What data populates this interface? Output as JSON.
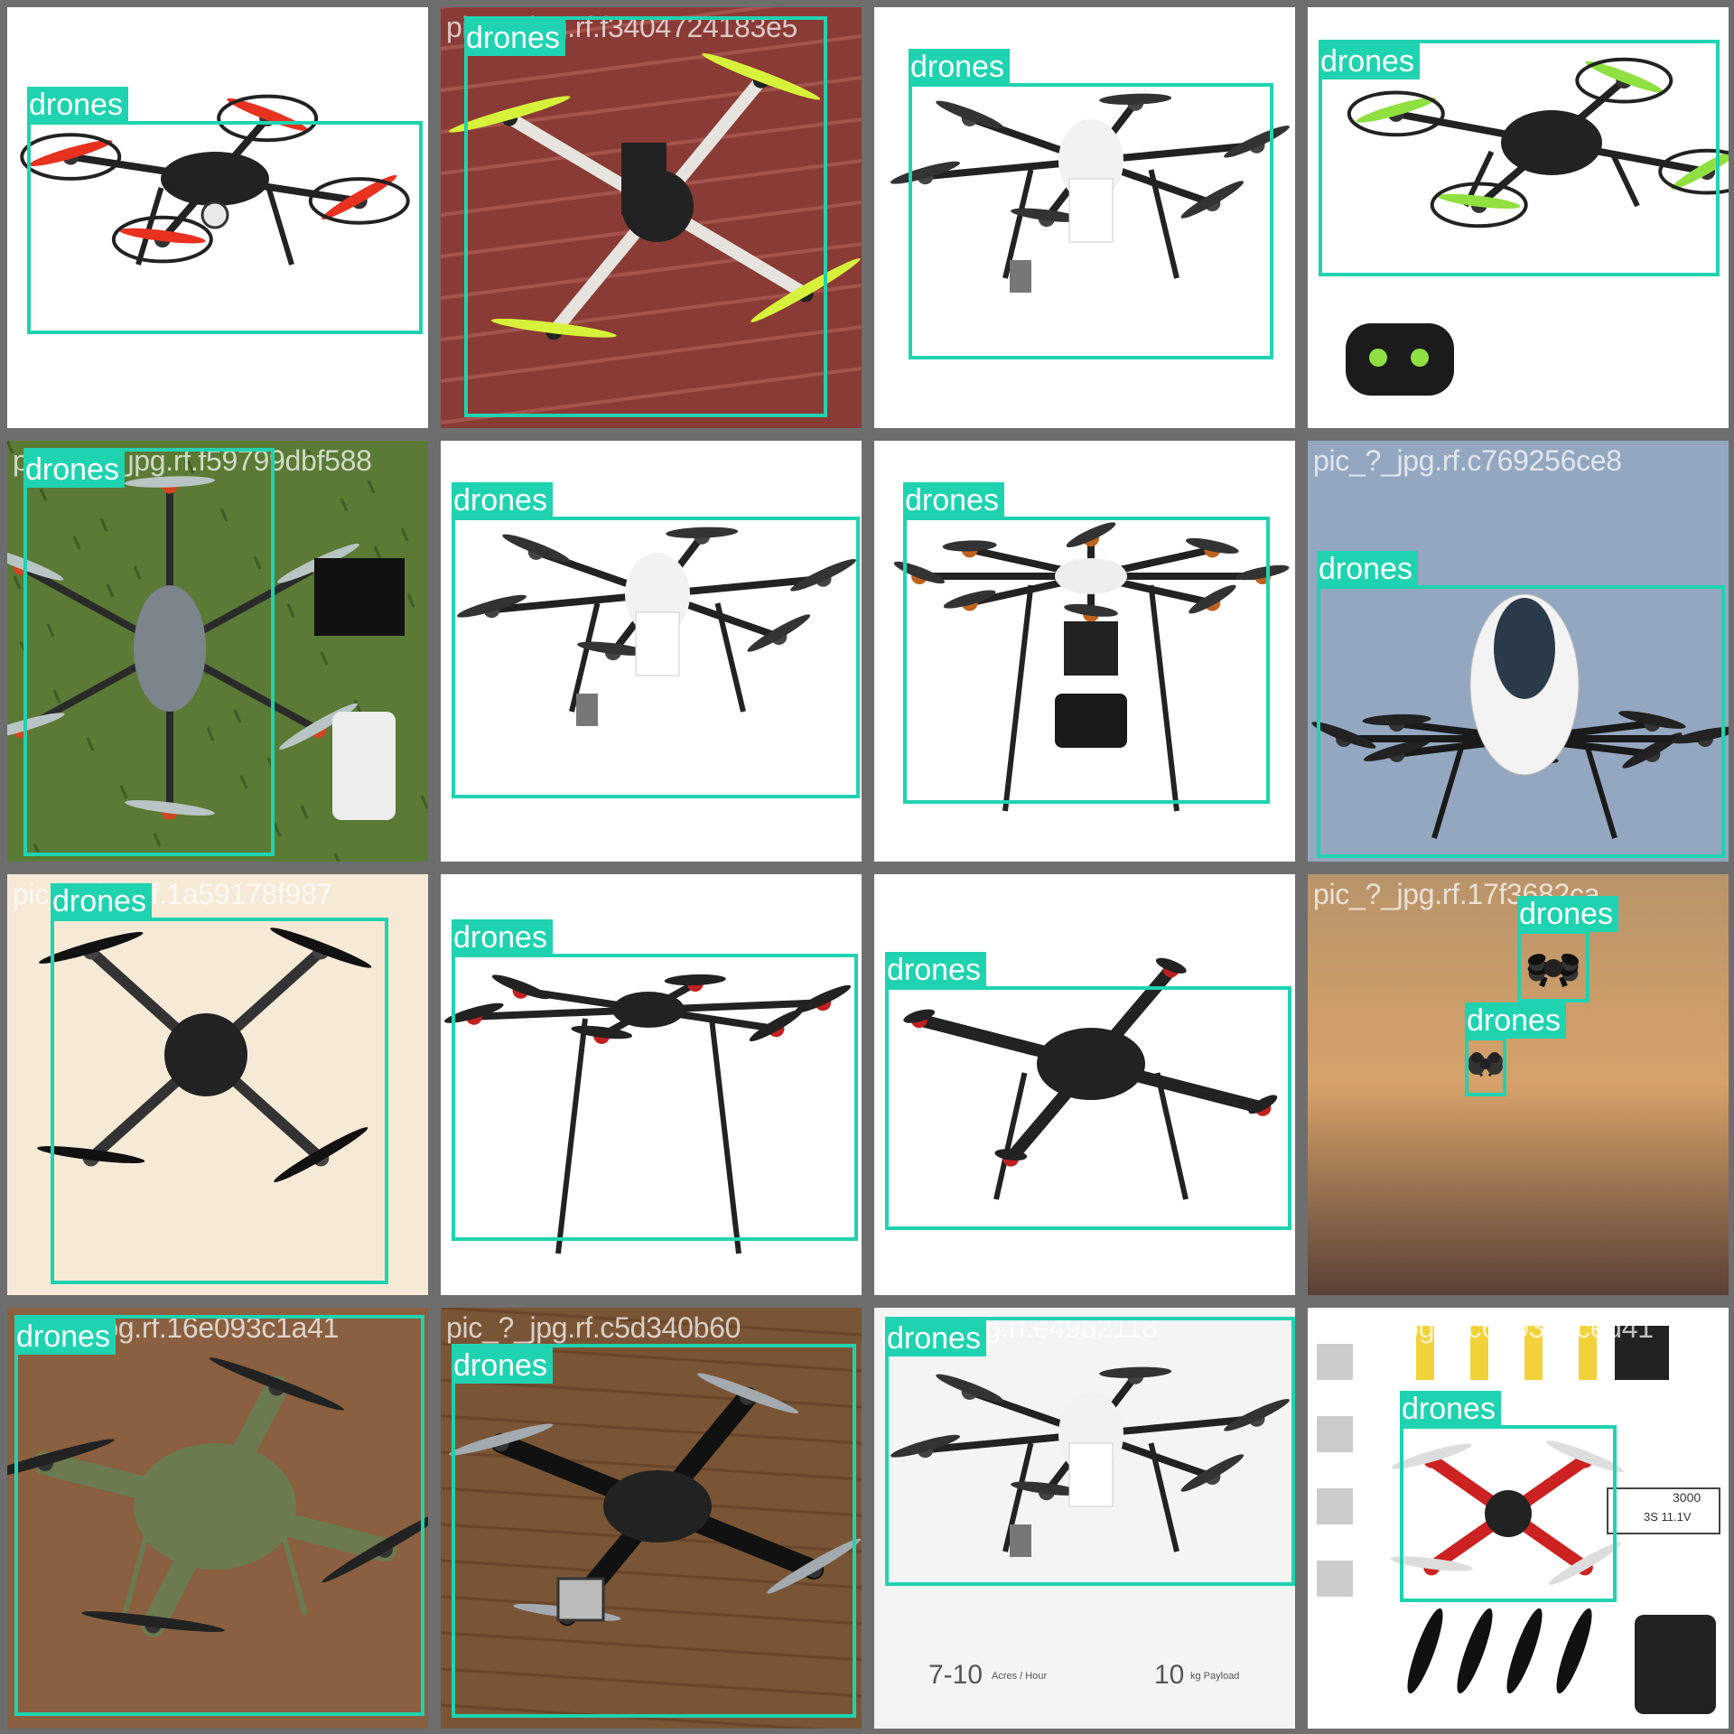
{
  "grid": {
    "tiles": [
      {
        "filename": "pic_522_jpg.rf.67db06e905",
        "background": "#ffffff",
        "scene": "quad-red",
        "boxes": [
          {
            "label": "drones"
          }
        ]
      },
      {
        "filename": "pic_?_jpg.rf.f3404724183e5",
        "background": "#8a3b35",
        "scene": "frame-yellow",
        "boxes": [
          {
            "label": "drones"
          }
        ]
      },
      {
        "filename": "pic_?_jpg.rf.abefaa9f4",
        "background": "#ffffff",
        "scene": "hexa-white",
        "boxes": [
          {
            "label": "drones"
          }
        ]
      },
      {
        "filename": "pic_?_jpg.rf.e29e107e63",
        "background": "#ffffff",
        "scene": "quad-green",
        "boxes": [
          {
            "label": "drones"
          }
        ]
      },
      {
        "filename": "pic_678_jpg.rf.f59799dbf588",
        "background": "#5a7a35",
        "scene": "hexa-grass",
        "boxes": [
          {
            "label": "drones"
          }
        ]
      },
      {
        "filename": "pic_?_jpg.rf.ce4ce4d9bea",
        "background": "#ffffff",
        "scene": "hexa-white",
        "boxes": [
          {
            "label": "drones"
          }
        ]
      },
      {
        "filename": "pic_?_jpg.rf.e59f43b0f85",
        "background": "#ffffff",
        "scene": "octo-camera",
        "boxes": [
          {
            "label": "drones"
          }
        ]
      },
      {
        "filename": "pic_?_jpg.rf.c769256ce8",
        "background": "#8fa3bd",
        "scene": "ehang",
        "boxes": [
          {
            "label": "drones"
          }
        ]
      },
      {
        "filename": "pic_?_jpg.rf.1a59178f987",
        "background": "#f6ead6",
        "scene": "quad-black",
        "boxes": [
          {
            "label": "drones"
          }
        ]
      },
      {
        "filename": "pic_?_jpg.rf.2428d51bae6",
        "background": "#ffffff",
        "scene": "hexa-m600",
        "boxes": [
          {
            "label": "drones"
          }
        ]
      },
      {
        "filename": "pic_?_jpg.rf.406cae4876",
        "background": "#ffffff",
        "scene": "quad-frame",
        "boxes": [
          {
            "label": "drones"
          }
        ]
      },
      {
        "filename": "pic_?_jpg.rf.17f3682ca",
        "background": "#c89a62",
        "scene": "sky",
        "boxes": [
          {
            "label": "drones"
          },
          {
            "label": "drones"
          }
        ]
      },
      {
        "filename": "pic_?_jpg.rf.16e093c1a41",
        "background": "#8a6040",
        "scene": "camo",
        "boxes": [
          {
            "label": "drones"
          }
        ]
      },
      {
        "filename": "pic_?_jpg.rf.c5d340b60",
        "background": "#7a5535",
        "scene": "floor-quad",
        "boxes": [
          {
            "label": "drones"
          }
        ]
      },
      {
        "filename": "pic_?_jpg.rf.e4982118",
        "background": "#f4f4f4",
        "scene": "agri-hexa",
        "texts": {
          "rate_value": "7-10",
          "rate_unit": "Acres / Hour",
          "payload_value": "10",
          "payload_unit": "kg Payload"
        },
        "boxes": [
          {
            "label": "drones"
          }
        ]
      },
      {
        "filename": "pic_?_jpg.rf.c6b039dced41",
        "background": "#ffffff",
        "scene": "kit",
        "texts": {
          "battery": "3000",
          "battery_spec": "3S 11.1V"
        },
        "boxes": [
          {
            "label": "drones"
          }
        ]
      }
    ]
  },
  "colors": {
    "box": "#1fd3b0",
    "label_text": "#ffffff",
    "divider": "#6e6e6e"
  }
}
